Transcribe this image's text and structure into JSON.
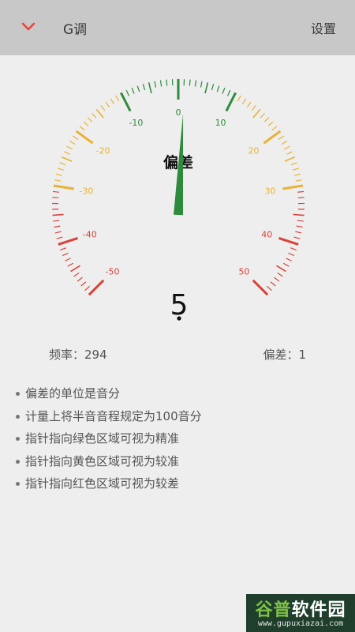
{
  "header": {
    "title": "G调",
    "settings_label": "设置"
  },
  "gauge": {
    "center_label": "偏差",
    "big_value": "5",
    "tick_labels": [
      {
        "value": -50,
        "text": "-50",
        "color": "#d9423a"
      },
      {
        "value": -40,
        "text": "-40",
        "color": "#d9423a"
      },
      {
        "value": -30,
        "text": "-30",
        "color": "#e9b234"
      },
      {
        "value": -20,
        "text": "-20",
        "color": "#e9b234"
      },
      {
        "value": -10,
        "text": "-10",
        "color": "#2e8b3e"
      },
      {
        "value": 0,
        "text": "0",
        "color": "#2e8b3e"
      },
      {
        "value": 10,
        "text": "10",
        "color": "#2e8b3e"
      },
      {
        "value": 20,
        "text": "20",
        "color": "#e9b234"
      },
      {
        "value": 30,
        "text": "30",
        "color": "#e9b234"
      },
      {
        "value": 40,
        "text": "40",
        "color": "#d9423a"
      },
      {
        "value": 50,
        "text": "50",
        "color": "#d9423a"
      }
    ],
    "range": [
      -50,
      50
    ],
    "needle_value": 1,
    "colors": {
      "green": "#2e8b3e",
      "yellow": "#e9b234",
      "red": "#d9423a",
      "needle": "#2e8b3e"
    }
  },
  "readouts": {
    "frequency_label": "频率：",
    "frequency_value": "294",
    "deviation_label": "偏差：",
    "deviation_value": "1"
  },
  "notes": [
    "偏差的单位是音分",
    "计量上将半音音程规定为100音分",
    "指针指向绿色区域可视为精准",
    "指针指向黄色区域可视为较准",
    "指针指向红色区域可视为较差"
  ],
  "watermark": {
    "brand_a": "谷普",
    "brand_b": "软件园",
    "url": "www.gupuxiazai.com"
  }
}
